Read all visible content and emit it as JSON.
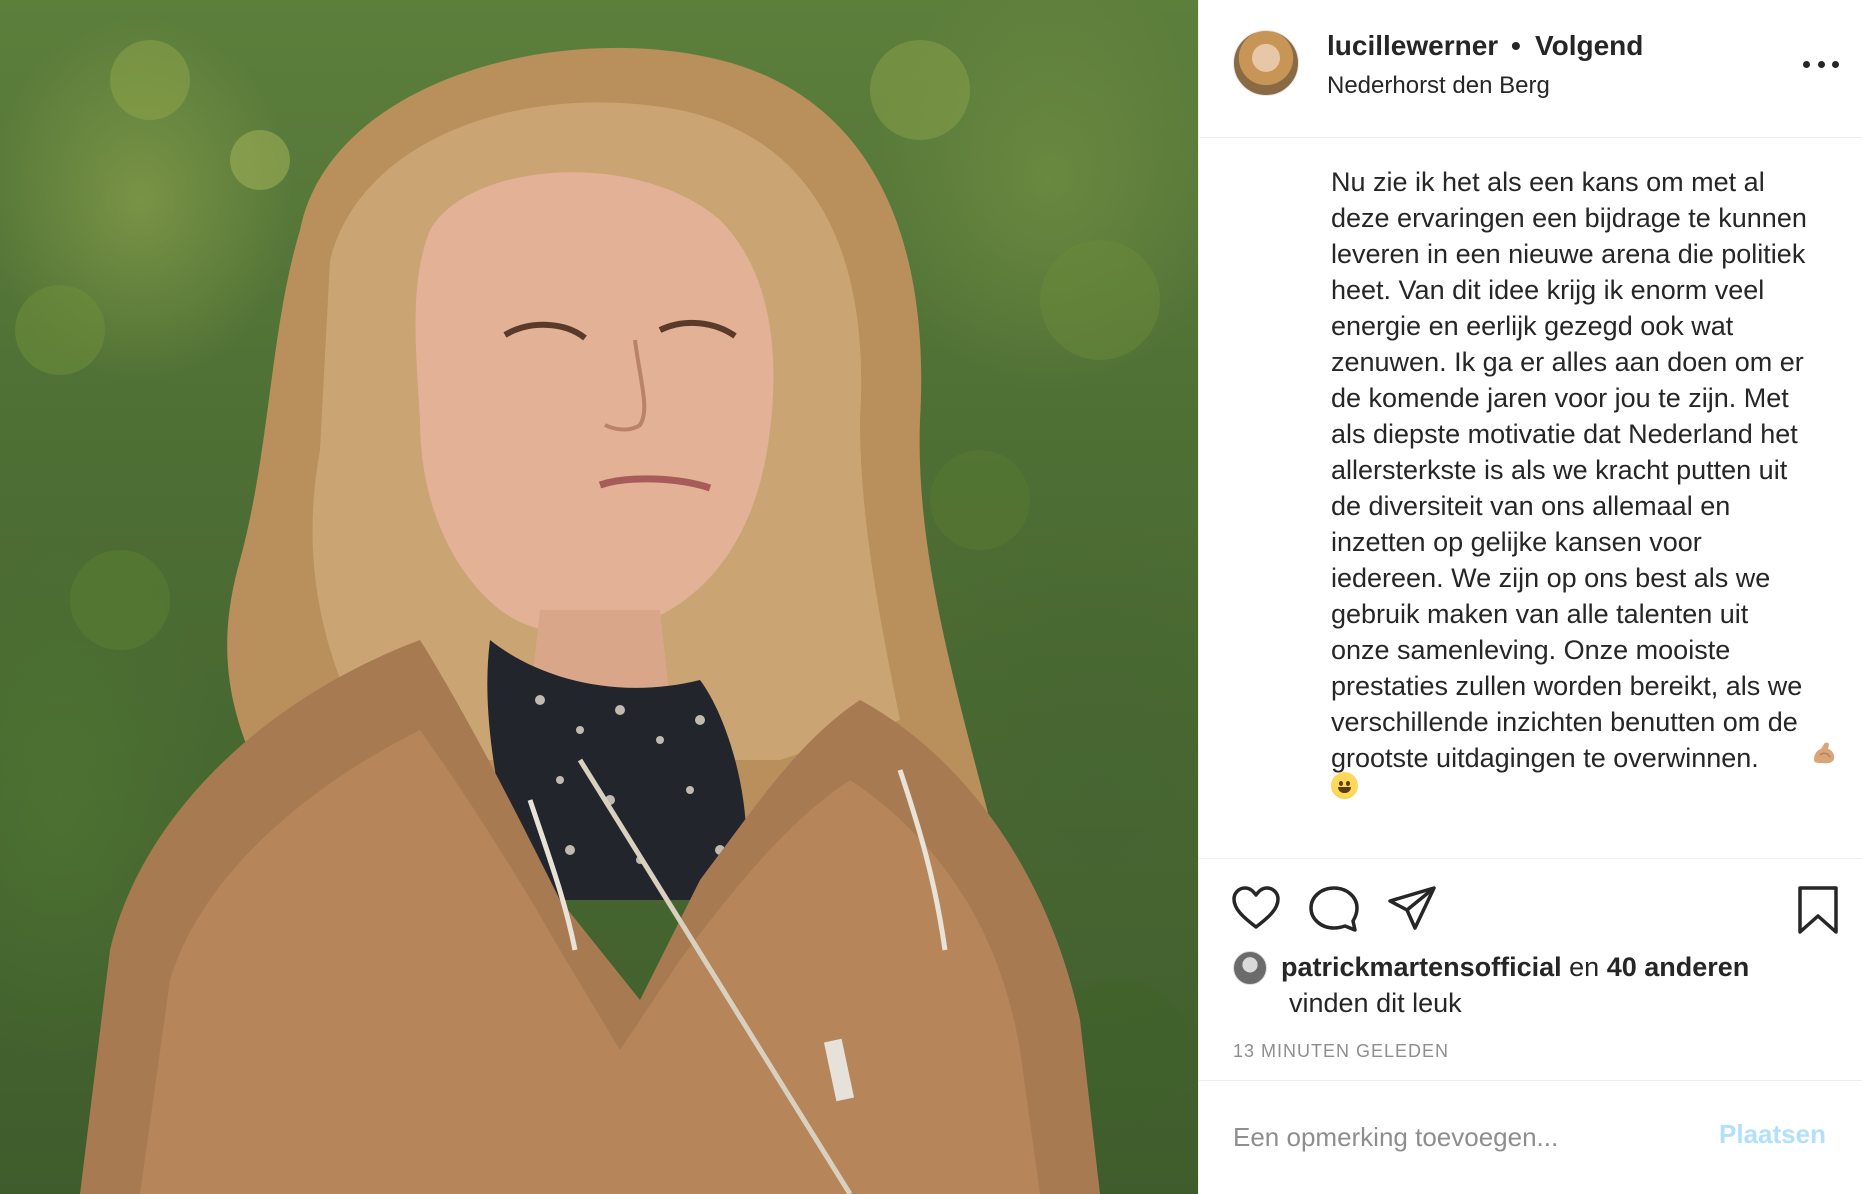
{
  "post": {
    "username": "lucillewerner",
    "separator": "•",
    "follow_status": "Volgend",
    "location": "Nederhorst den Berg",
    "caption": "Nu zie ik het als een kans om met al\ndeze ervaringen een bijdrage te kunnen\nleveren in een nieuwe arena die politiek\nheet. Van dit idee krijg ik enorm veel\nenergie en eerlijk gezegd ook wat\nzenuwen. Ik ga er alles aan doen om er\nde komende jaren voor jou te zijn. Met\nals diepste motivatie dat Nederland het\nallersterkste is als we kracht putten uit\nde diversiteit van ons allemaal en\ninzetten op gelijke kansen voor\niedereen. We zijn op ons best als we\ngebruik maken van alle talenten uit\nonze samenleving. Onze mooiste\nprestaties zullen worden bereikt, als we\nverschillende inzichten benutten om de\ngrootste uitdagingen te overwinnen.",
    "caption_emojis": [
      "flexed-biceps-emoji",
      "grinning-face-emoji"
    ]
  },
  "likes": {
    "liker": "patrickmartensofficial",
    "joiner": "en",
    "others": "40 anderen",
    "suffix": "vinden dit leuk"
  },
  "timestamp": "13 MINUTEN GELEDEN",
  "comment": {
    "placeholder": "Een opmerking toevoegen...",
    "post_label": "Plaatsen"
  },
  "icons": [
    "heart-icon",
    "comment-icon",
    "share-icon",
    "bookmark-icon",
    "more-options-icon"
  ],
  "colors": {
    "text": "#262626",
    "secondary": "#8e8e8e",
    "divider": "#efefef",
    "post_button_disabled": "#b2dffc"
  }
}
